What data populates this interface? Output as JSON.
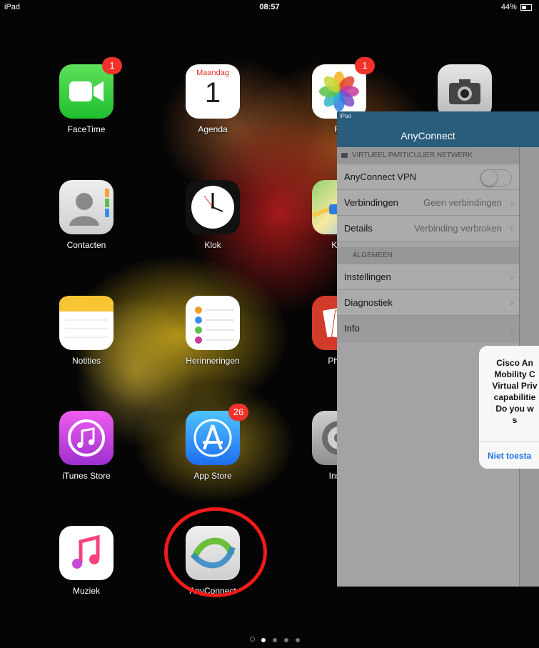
{
  "status_bar": {
    "device": "iPad",
    "time": "08:57",
    "battery": "44%"
  },
  "home": {
    "apps": [
      {
        "label": "FaceTime",
        "badge": "1",
        "icon": "facetime-icon"
      },
      {
        "label": "Agenda",
        "icon": "calendar-icon",
        "weekday": "Maandag",
        "day": "1"
      },
      {
        "label": "Fo",
        "badge": "1",
        "icon": "photos-icon"
      },
      {
        "label": "",
        "icon": "camera-icon"
      },
      {
        "label": "Contacten",
        "icon": "contacts-icon"
      },
      {
        "label": "Klok",
        "icon": "clock-icon"
      },
      {
        "label": "Kaa",
        "icon": "maps-icon"
      },
      {
        "label": "Notities",
        "icon": "notes-icon"
      },
      {
        "label": "Herinneringen",
        "icon": "reminders-icon"
      },
      {
        "label": "Photo",
        "icon": "photo-booth-icon"
      },
      {
        "label": "iTunes Store",
        "icon": "itunes-store-icon"
      },
      {
        "label": "App Store",
        "badge": "26",
        "icon": "app-store-icon"
      },
      {
        "label": "Instel",
        "icon": "settings-icon"
      },
      {
        "label": "Muziek",
        "icon": "music-icon"
      },
      {
        "label": "AnyConnect",
        "icon": "anyconnect-icon"
      }
    ]
  },
  "anyconnect": {
    "status": "iPad",
    "title": "AnyConnect",
    "section_vpn": "VIRTUEEL PARTICULIER NETWERK",
    "rows": [
      {
        "label": "AnyConnect VPN",
        "value": ""
      },
      {
        "label": "Verbindingen",
        "value": "Geen verbindingen"
      },
      {
        "label": "Details",
        "value": "Verbinding verbroken"
      }
    ],
    "section_general": "ALGEMEEN",
    "general_rows": [
      {
        "label": "Instellingen"
      },
      {
        "label": "Diagnostiek"
      },
      {
        "label": "Info"
      }
    ]
  },
  "alert": {
    "lines": [
      "Cisco An",
      "Mobility C",
      "Virtual Priv",
      "capabilitie",
      "Do you w",
      "s"
    ],
    "button": "Niet toesta"
  },
  "page_dots": {
    "count": 5,
    "active": 1
  },
  "colors": {
    "accent": "#2a5d7c",
    "badge": "#f0322a",
    "highlight_ring": "#ef1a1a",
    "link": "#1a72e8"
  }
}
